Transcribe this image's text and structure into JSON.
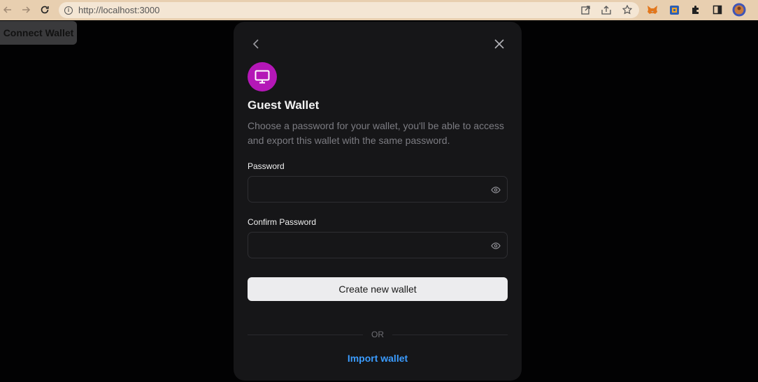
{
  "browser": {
    "url": "http://localhost:3000",
    "back_icon": "arrow-left-icon",
    "forward_icon": "arrow-right-icon",
    "reload_icon": "reload-icon"
  },
  "page": {
    "connect_label": "Connect Wallet"
  },
  "modal": {
    "title": "Guest Wallet",
    "description": "Choose a password for your wallet, you'll be able to access and export this wallet with the same password.",
    "password_label": "Password",
    "password_value": "",
    "confirm_label": "Confirm Password",
    "confirm_value": "",
    "create_label": "Create new wallet",
    "or_label": "OR",
    "import_label": "Import wallet"
  },
  "colors": {
    "accent": "#3b9cff",
    "avatar": "#b417b7",
    "modal_bg": "#161618",
    "page_bg": "#020203"
  }
}
